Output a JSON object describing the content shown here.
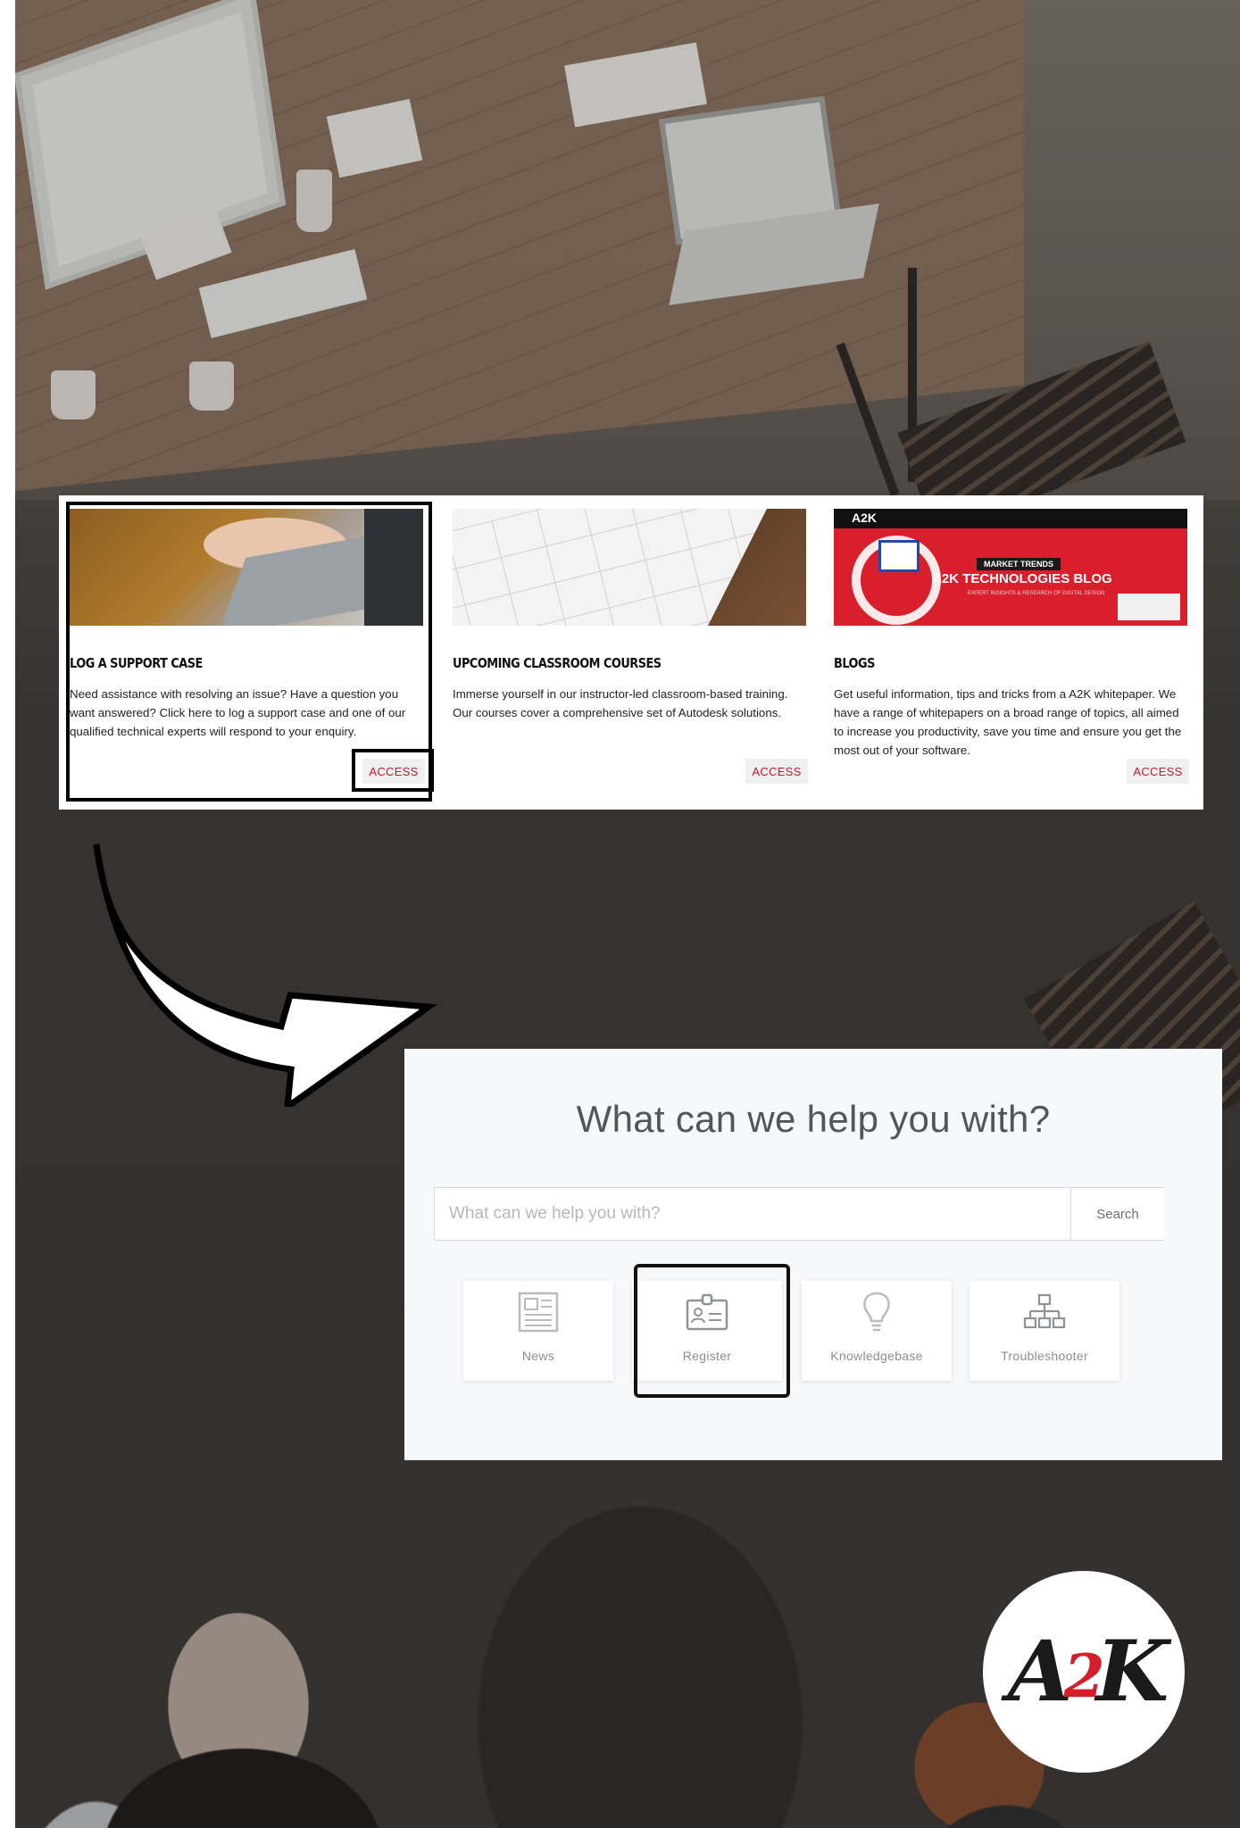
{
  "cards": [
    {
      "title": "LOG A SUPPORT CASE",
      "text": "Need assistance with resolving an issue?  Have a question you want answered?  Click here to log a support case and one of our qualified technical experts will respond to your enquiry.",
      "button": "ACCESS",
      "image_icon": "laptop-typing-photo"
    },
    {
      "title": "UPCOMING CLASSROOM COURSES",
      "text": "Immerse yourself in our instructor-led classroom-based training. Our courses cover a comprehensive set of Autodesk solutions.",
      "button": "ACCESS",
      "image_icon": "calendar-photo"
    },
    {
      "title": "BLOGS",
      "text": "Get useful information, tips and tricks from a A2K whitepaper.  We have a range of whitepapers on a broad range of topics, all aimed to increase you productivity, save you time and ensure you get the most out of your software.",
      "button": "ACCESS",
      "image_icon": "blog-banner-image",
      "banner": {
        "logo": "A2K",
        "tag": "MARKET TRENDS",
        "title": "A2K TECHNOLOGIES BLOG",
        "subtitle": "EXPERT INSIGHTS & RESEARCH OF DIGITAL DESIGN"
      }
    }
  ],
  "help": {
    "title": "What can we help you with?",
    "search_placeholder": "What can we help you with?",
    "search_button": "Search",
    "tiles": [
      {
        "label": "News",
        "icon": "newspaper-icon"
      },
      {
        "label": "Register",
        "icon": "id-card-icon"
      },
      {
        "label": "Knowledgebase",
        "icon": "lightbulb-icon"
      },
      {
        "label": "Troubleshooter",
        "icon": "sitemap-icon"
      }
    ]
  },
  "logo": {
    "first": "A",
    "middle": "2",
    "last": "K"
  },
  "colors": {
    "accent_red": "#c7182d",
    "panel_bg": "#f7f8fa",
    "highlight_border": "#000000"
  }
}
